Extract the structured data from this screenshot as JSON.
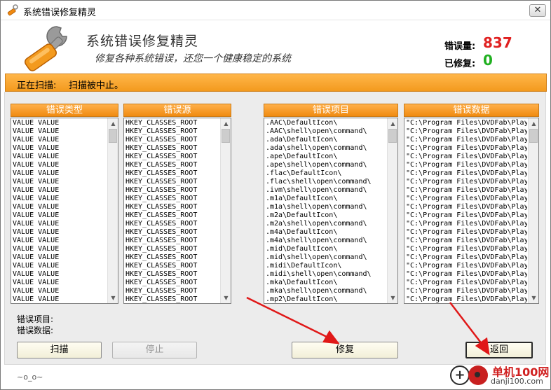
{
  "window": {
    "title": "系统错误修复精灵",
    "close_glyph": "✕"
  },
  "header": {
    "app_title": "系统错误修复精灵",
    "subtitle": "修复各种系统错误，还您一个健康稳定的系统",
    "errors_label": "错误量:",
    "errors_value": "837",
    "fixed_label": "已修复:",
    "fixed_value": "0"
  },
  "scan": {
    "label": "正在扫描:",
    "status": "扫描被中止。"
  },
  "panels": [
    {
      "header": "错误类型",
      "rows": [
        "VALUE  VALUE",
        "VALUE  VALUE",
        "VALUE  VALUE",
        "VALUE  VALUE",
        "VALUE  VALUE",
        "VALUE  VALUE",
        "VALUE  VALUE",
        "VALUE  VALUE",
        "VALUE  VALUE",
        "VALUE  VALUE",
        "VALUE  VALUE",
        "VALUE  VALUE",
        "VALUE  VALUE",
        "VALUE  VALUE",
        "VALUE  VALUE",
        "VALUE  VALUE",
        "VALUE  VALUE",
        "VALUE  VALUE",
        "VALUE  VALUE",
        "VALUE  VALUE",
        "VALUE  VALUE",
        "VALUE  VALUE"
      ]
    },
    {
      "header": "错误源",
      "rows": [
        "HKEY_CLASSES_ROOT",
        "HKEY_CLASSES_ROOT",
        "HKEY_CLASSES_ROOT",
        "HKEY_CLASSES_ROOT",
        "HKEY_CLASSES_ROOT",
        "HKEY_CLASSES_ROOT",
        "HKEY_CLASSES_ROOT",
        "HKEY_CLASSES_ROOT",
        "HKEY_CLASSES_ROOT",
        "HKEY_CLASSES_ROOT",
        "HKEY_CLASSES_ROOT",
        "HKEY_CLASSES_ROOT",
        "HKEY_CLASSES_ROOT",
        "HKEY_CLASSES_ROOT",
        "HKEY_CLASSES_ROOT",
        "HKEY_CLASSES_ROOT",
        "HKEY_CLASSES_ROOT",
        "HKEY_CLASSES_ROOT",
        "HKEY_CLASSES_ROOT",
        "HKEY_CLASSES_ROOT",
        "HKEY_CLASSES_ROOT",
        "HKEY_CLASSES_ROOT"
      ]
    },
    {
      "header": "错误项目",
      "rows": [
        ".AAC\\DefaultIcon\\",
        ".AAC\\shell\\open\\command\\",
        ".ada\\DefaultIcon\\",
        ".ada\\shell\\open\\command\\",
        ".ape\\DefaultIcon\\",
        ".ape\\shell\\open\\command\\",
        ".flac\\DefaultIcon\\",
        ".flac\\shell\\open\\command\\",
        ".ivm\\shell\\open\\command\\",
        ".m1a\\DefaultIcon\\",
        ".m1a\\shell\\open\\command\\",
        ".m2a\\DefaultIcon\\",
        ".m2a\\shell\\open\\command\\",
        ".m4a\\DefaultIcon\\",
        ".m4a\\shell\\open\\command\\",
        ".mid\\DefaultIcon\\",
        ".mid\\shell\\open\\command\\",
        ".midi\\DefaultIcon\\",
        ".midi\\shell\\open\\command\\",
        ".mka\\DefaultIcon\\",
        ".mka\\shell\\open\\command\\",
        ".mp2\\DefaultIcon\\"
      ]
    },
    {
      "header": "错误数据",
      "rows": [
        "\"C:\\Program Files\\DVDFab\\Play",
        "\"C:\\Program Files\\DVDFab\\Play",
        "\"C:\\Program Files\\DVDFab\\Play",
        "\"C:\\Program Files\\DVDFab\\Play",
        "\"C:\\Program Files\\DVDFab\\Play",
        "\"C:\\Program Files\\DVDFab\\Play",
        "\"C:\\Program Files\\DVDFab\\Play",
        "\"C:\\Program Files\\DVDFab\\Play",
        "\"C:\\Program Files\\DVDFab\\Play",
        "\"C:\\Program Files\\DVDFab\\Play",
        "\"C:\\Program Files\\DVDFab\\Play",
        "\"C:\\Program Files\\DVDFab\\Play",
        "\"C:\\Program Files\\DVDFab\\Play",
        "\"C:\\Program Files\\DVDFab\\Play",
        "\"C:\\Program Files\\DVDFab\\Play",
        "\"C:\\Program Files\\DVDFab\\Play",
        "\"C:\\Program Files\\DVDFab\\Play",
        "\"C:\\Program Files\\DVDFab\\Play",
        "\"C:\\Program Files\\DVDFab\\Play",
        "\"C:\\Program Files\\DVDFab\\Play",
        "\"C:\\Program Files\\DVDFab\\Play",
        "\"C:\\Program Files\\DVDFab\\Play"
      ]
    }
  ],
  "info": {
    "item_label": "错误项目:",
    "data_label": "错误数据:"
  },
  "buttons": {
    "scan": "扫描",
    "stop": "停止",
    "fix": "修复",
    "back": "返回"
  },
  "footer": {
    "text": "~o_o~"
  },
  "watermark": {
    "name": "单机100网",
    "url": "danji100.com",
    "plus_glyph": "+"
  },
  "colors": {
    "accent_orange": "#f39a1e",
    "errors_red": "#e02020",
    "fixed_green": "#20b020",
    "arrow_red": "#e01818"
  }
}
